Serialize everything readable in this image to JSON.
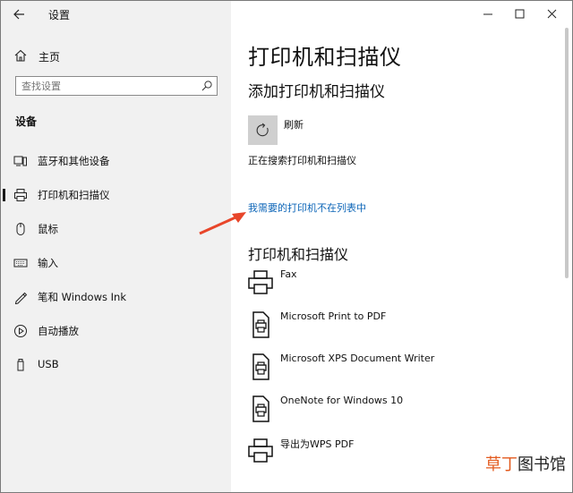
{
  "window": {
    "title": "设置",
    "controls": [
      "minimize",
      "maximize",
      "close"
    ]
  },
  "sidebar": {
    "home_label": "主页",
    "search_placeholder": "查找设置",
    "section_title": "设备",
    "items": [
      {
        "label": "蓝牙和其他设备",
        "icon": "bluetooth-devices-icon"
      },
      {
        "label": "打印机和扫描仪",
        "icon": "printer-icon",
        "selected": true
      },
      {
        "label": "鼠标",
        "icon": "mouse-icon"
      },
      {
        "label": "输入",
        "icon": "keyboard-icon"
      },
      {
        "label": "笔和 Windows Ink",
        "icon": "pen-icon"
      },
      {
        "label": "自动播放",
        "icon": "autoplay-icon"
      },
      {
        "label": "USB",
        "icon": "usb-icon"
      }
    ]
  },
  "main": {
    "page_title": "打印机和扫描仪",
    "add_heading": "添加打印机和扫描仪",
    "refresh_label": "刷新",
    "searching_text": "正在搜索打印机和扫描仪",
    "not_listed_link": "我需要的打印机不在列表中",
    "printers_heading": "打印机和扫描仪",
    "devices": [
      {
        "name": "Fax",
        "icon": "printer-icon"
      },
      {
        "name": "Microsoft Print to PDF",
        "icon": "document-printer-icon"
      },
      {
        "name": "Microsoft XPS Document Writer",
        "icon": "document-printer-icon"
      },
      {
        "name": "OneNote for Windows 10",
        "icon": "document-printer-icon"
      },
      {
        "name": "导出为WPS PDF",
        "icon": "printer-icon"
      }
    ]
  },
  "annotation": {
    "arrow_color": "#e8462a"
  },
  "watermark": {
    "brand": "草丁",
    "rest": "图书馆"
  },
  "colors": {
    "link": "#0e66b8",
    "sidebar_bg": "#f1f1f1",
    "accent_selected": "#1a1a1a"
  }
}
